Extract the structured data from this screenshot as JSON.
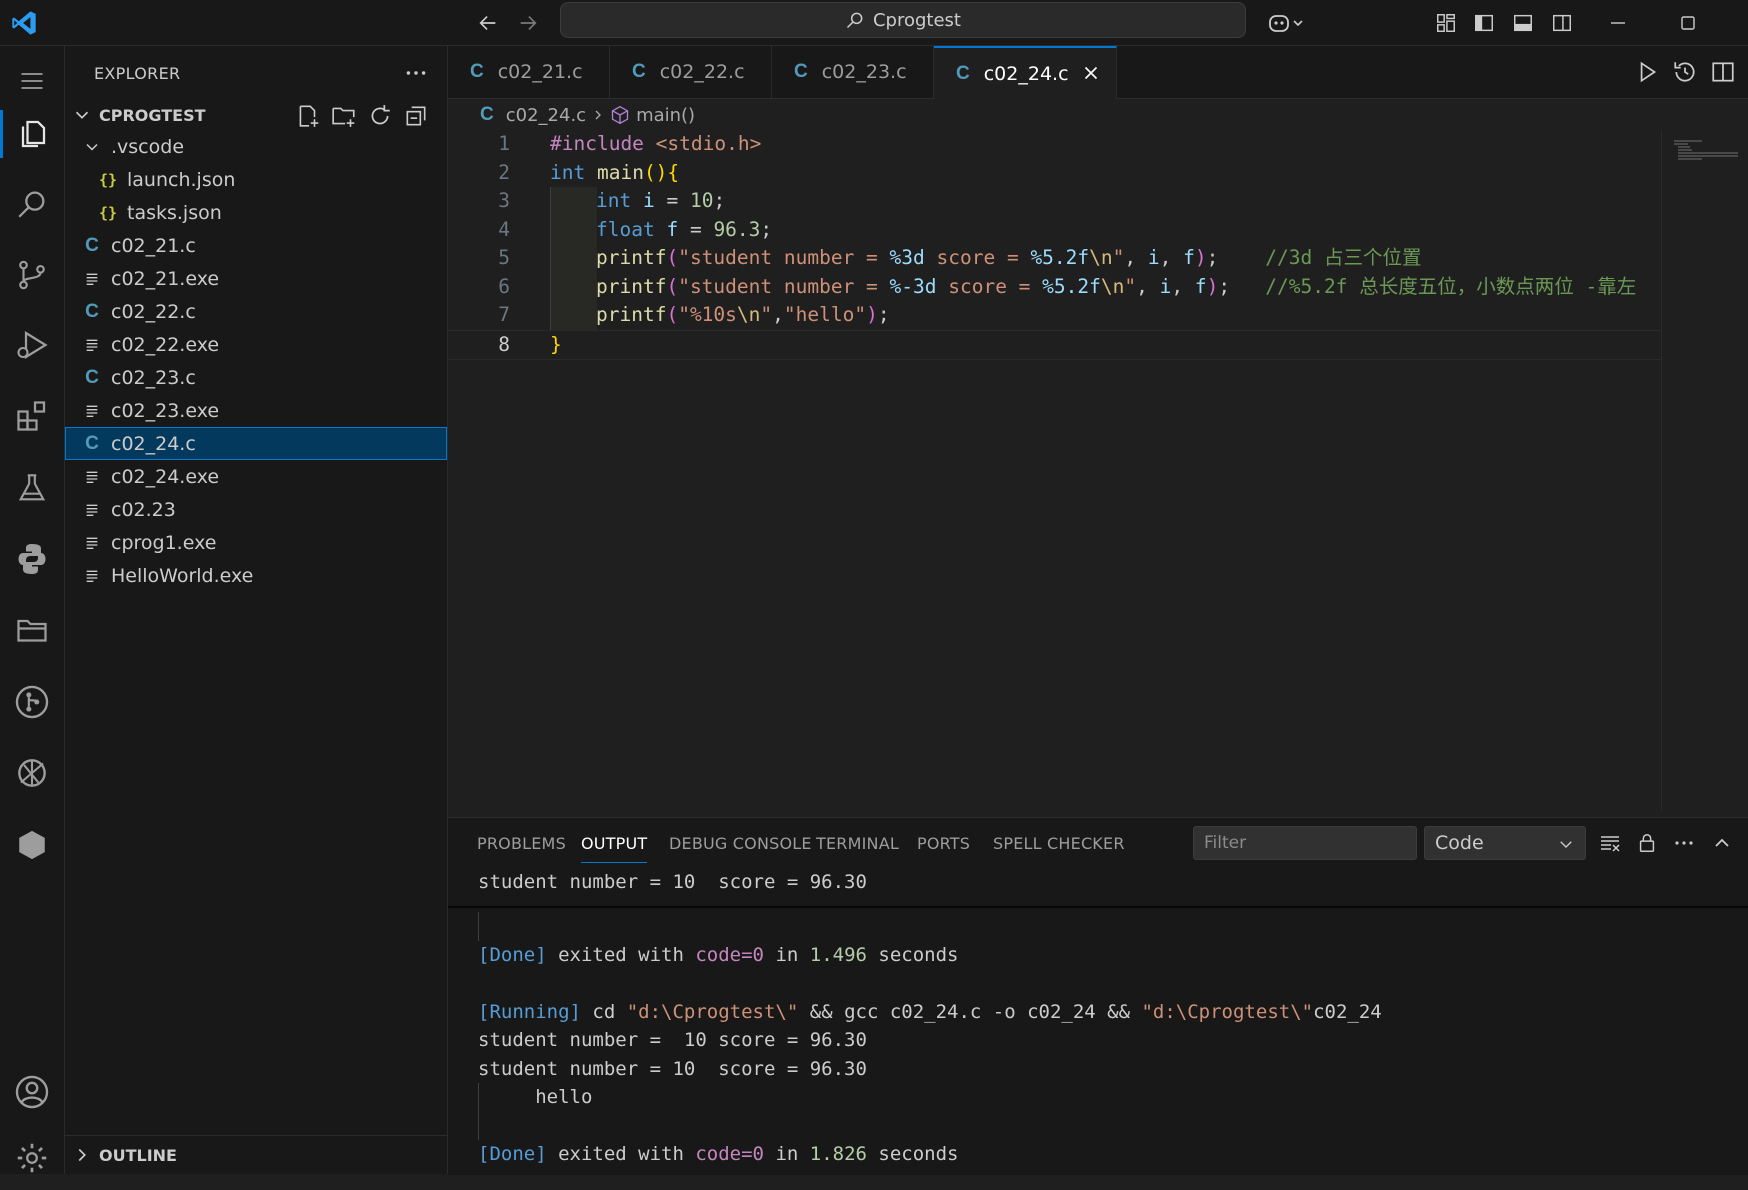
{
  "titlebar": {
    "search_label": "Cprogtest"
  },
  "activity": {
    "items": [
      "menu",
      "explorer",
      "search",
      "source-control",
      "run-debug",
      "extensions",
      "testing",
      "python",
      "remote-explorer",
      "git-graph",
      "live-share",
      "containers"
    ],
    "bottom": [
      "accounts",
      "manage"
    ]
  },
  "sidebar": {
    "title": "EXPLORER",
    "folder": "CPROGTEST",
    "tree": [
      {
        "name": ".vscode",
        "kind": "folder",
        "depth": 1
      },
      {
        "name": "launch.json",
        "kind": "json",
        "depth": 2
      },
      {
        "name": "tasks.json",
        "kind": "json",
        "depth": 2
      },
      {
        "name": "c02_21.c",
        "kind": "c",
        "depth": 1
      },
      {
        "name": "c02_21.exe",
        "kind": "exe",
        "depth": 1
      },
      {
        "name": "c02_22.c",
        "kind": "c",
        "depth": 1
      },
      {
        "name": "c02_22.exe",
        "kind": "exe",
        "depth": 1
      },
      {
        "name": "c02_23.c",
        "kind": "c",
        "depth": 1
      },
      {
        "name": "c02_23.exe",
        "kind": "exe",
        "depth": 1
      },
      {
        "name": "c02_24.c",
        "kind": "c",
        "depth": 1,
        "selected": true
      },
      {
        "name": "c02_24.exe",
        "kind": "exe",
        "depth": 1
      },
      {
        "name": "c02.23",
        "kind": "exe",
        "depth": 1
      },
      {
        "name": "cprog1.exe",
        "kind": "exe",
        "depth": 1
      },
      {
        "name": "HelloWorld.exe",
        "kind": "exe",
        "depth": 1
      }
    ],
    "outline_label": "OUTLINE"
  },
  "editor": {
    "tabs": [
      {
        "label": "c02_21.c",
        "icon": "C"
      },
      {
        "label": "c02_22.c",
        "icon": "C"
      },
      {
        "label": "c02_23.c",
        "icon": "C"
      },
      {
        "label": "c02_24.c",
        "icon": "C",
        "active": true
      }
    ],
    "breadcrumb": {
      "file": "c02_24.c",
      "symbol": "main()"
    },
    "current_line": 8,
    "lines": [
      [
        [
          "#include ",
          "t-ctl"
        ],
        [
          "<stdio.h>",
          "t-str"
        ]
      ],
      [
        [
          "int ",
          "t-kw"
        ],
        [
          "main",
          "t-fn"
        ],
        [
          "(){",
          "t-brace"
        ]
      ],
      [
        [
          "int ",
          "t-kw"
        ],
        [
          "i",
          "t-var"
        ],
        [
          " = ",
          ""
        ],
        [
          "10",
          "t-num"
        ],
        [
          ";",
          ""
        ]
      ],
      [
        [
          "float ",
          "t-kw"
        ],
        [
          "f",
          "t-var"
        ],
        [
          " = ",
          ""
        ],
        [
          "96.3",
          "t-num"
        ],
        [
          ";",
          ""
        ]
      ],
      [
        [
          "printf",
          "t-fn"
        ],
        [
          "(",
          "t-paren"
        ],
        [
          "\"student number = ",
          "t-str"
        ],
        [
          "%3d",
          "t-fmt"
        ],
        [
          " score = ",
          "t-str"
        ],
        [
          "%5.2f",
          "t-fmt"
        ],
        [
          "\\n",
          "t-esc"
        ],
        [
          "\"",
          "t-str"
        ],
        [
          ", ",
          ""
        ],
        [
          "i",
          "t-var"
        ],
        [
          ", ",
          ""
        ],
        [
          "f",
          "t-var"
        ],
        [
          ")",
          "t-paren"
        ],
        [
          ";",
          ""
        ],
        [
          "    //3d 占三个位置",
          "t-cmt"
        ]
      ],
      [
        [
          "printf",
          "t-fn"
        ],
        [
          "(",
          "t-paren"
        ],
        [
          "\"student number = ",
          "t-str"
        ],
        [
          "%-3d",
          "t-fmt"
        ],
        [
          " score = ",
          "t-str"
        ],
        [
          "%5.2f",
          "t-fmt"
        ],
        [
          "\\n",
          "t-esc"
        ],
        [
          "\"",
          "t-str"
        ],
        [
          ", ",
          ""
        ],
        [
          "i",
          "t-var"
        ],
        [
          ", ",
          ""
        ],
        [
          "f",
          "t-var"
        ],
        [
          ")",
          "t-paren"
        ],
        [
          ";",
          ""
        ],
        [
          "   //%5.2f 总长度五位，小数点两位 -靠左",
          "t-cmt"
        ]
      ],
      [
        [
          "printf",
          "t-fn"
        ],
        [
          "(",
          "t-paren"
        ],
        [
          "\"%10s",
          "t-str"
        ],
        [
          "\\n",
          "t-esc"
        ],
        [
          "\"",
          "t-str"
        ],
        [
          ",",
          ""
        ],
        [
          "\"hello\"",
          "t-str"
        ],
        [
          ")",
          "t-paren"
        ],
        [
          ";",
          ""
        ]
      ],
      [
        [
          "}",
          "t-brace"
        ]
      ]
    ],
    "indented_lines": [
      3,
      4,
      5,
      6,
      7
    ]
  },
  "panel": {
    "tabs": [
      "PROBLEMS",
      "OUTPUT",
      "DEBUG CONSOLE",
      "TERMINAL",
      "PORTS",
      "SPELL CHECKER"
    ],
    "active_tab": "OUTPUT",
    "filter_placeholder": "Filter",
    "channel": "Code",
    "output": [
      {
        "text": [
          [
            "student number = 10  score = 96.30",
            ""
          ]
        ]
      },
      {
        "text": [],
        "guide": true
      },
      {
        "text": [
          [
            "[Done]",
            "o-tag"
          ],
          [
            " exited with ",
            ""
          ],
          [
            "code=0",
            "o-kw"
          ],
          [
            " in ",
            ""
          ],
          [
            "1.496",
            "o-num"
          ],
          [
            " seconds",
            ""
          ]
        ]
      },
      {
        "text": []
      },
      {
        "text": [
          [
            "[Running]",
            "o-tag"
          ],
          [
            " cd ",
            ""
          ],
          [
            "\"d:\\Cprogtest\\\"",
            "o-path"
          ],
          [
            " && gcc c02_24.c -o c02_24 && ",
            ""
          ],
          [
            "\"d:\\Cprogtest\\\"",
            "o-path"
          ],
          [
            "c02_24",
            ""
          ]
        ]
      },
      {
        "text": [
          [
            "student number =  10 score = 96.30",
            ""
          ]
        ]
      },
      {
        "text": [
          [
            "student number = 10  score = 96.30",
            ""
          ]
        ]
      },
      {
        "text": [
          [
            "     hello",
            ""
          ]
        ],
        "guide": true
      },
      {
        "text": [],
        "guide": true
      },
      {
        "text": [
          [
            "[Done]",
            "o-tag"
          ],
          [
            " exited with ",
            ""
          ],
          [
            "code=0",
            "o-kw"
          ],
          [
            " in ",
            ""
          ],
          [
            "1.826",
            "o-num"
          ],
          [
            " seconds",
            ""
          ]
        ]
      }
    ]
  }
}
